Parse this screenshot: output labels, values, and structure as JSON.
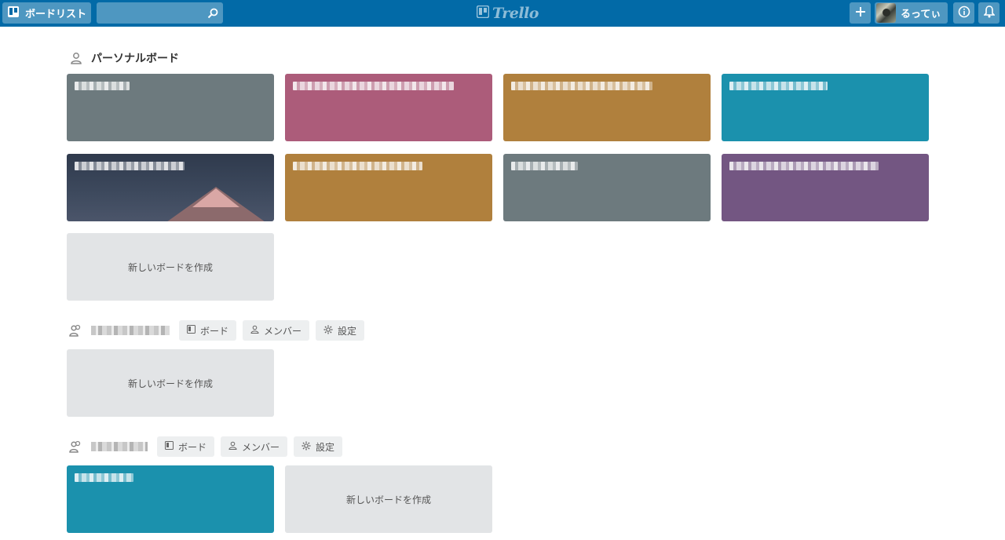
{
  "header": {
    "board_list_label": "ボードリスト",
    "search_placeholder": "",
    "logo_text": "Trello",
    "user_name": "るってぃ",
    "color": "#026aa7"
  },
  "personal": {
    "title": "パーソナルボード",
    "boards": [
      {
        "color": "#6d7a7e"
      },
      {
        "color": "#ac5c7a"
      },
      {
        "color": "#b0803d"
      },
      {
        "color": "#1b91ad"
      },
      {
        "color": "#3c4658"
      },
      {
        "color": "#b0803d"
      },
      {
        "color": "#6d7a7e"
      },
      {
        "color": "#735682"
      }
    ],
    "create_label": "新しいボードを作成"
  },
  "team1": {
    "tabs": {
      "boards": "ボード",
      "members": "メンバー",
      "settings": "設定"
    },
    "create_label": "新しいボードを作成"
  },
  "team2": {
    "tabs": {
      "boards": "ボード",
      "members": "メンバー",
      "settings": "設定"
    },
    "boards": [
      {
        "color": "#1b91ad"
      }
    ],
    "create_label": "新しいボードを作成"
  }
}
